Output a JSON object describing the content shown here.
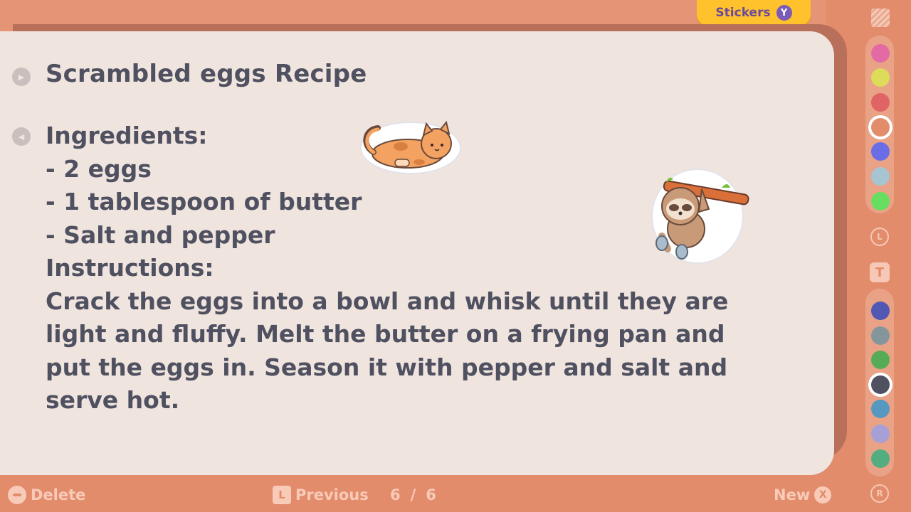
{
  "note": {
    "title": "Scrambled eggs Recipe",
    "lines": [
      "Ingredients:",
      "- 2 eggs",
      "- 1 tablespoon of butter",
      "- Salt and pepper",
      "Instructions:",
      "Crack the eggs into a bowl and whisk until they are light and fluffy. Melt the butter on a frying pan and put the eggs in. Season it with pepper and salt and serve hot."
    ]
  },
  "stickers_tab": {
    "label": "Stickers",
    "button": "Y"
  },
  "palette": {
    "top_colors": [
      "#e46aa6",
      "#dcdc5a",
      "#e06464",
      "#e38c6c",
      "#6a6ee6",
      "#a6c4d2",
      "#68de60"
    ],
    "top_selected_index": 3,
    "bottom_colors": [
      "#5058b4",
      "#84969c",
      "#56ac56",
      "#4f5060",
      "#5698c0",
      "#a6a0d6",
      "#52ae80"
    ],
    "bottom_selected_index": 3,
    "l_button": "L",
    "r_button": "R",
    "text_tool": "T"
  },
  "bottom_bar": {
    "delete_label": "Delete",
    "previous_label": "Previous",
    "previous_button": "L",
    "page_current": "6",
    "page_separator": "/",
    "page_total": "6",
    "new_label": "New",
    "new_button": "X"
  }
}
